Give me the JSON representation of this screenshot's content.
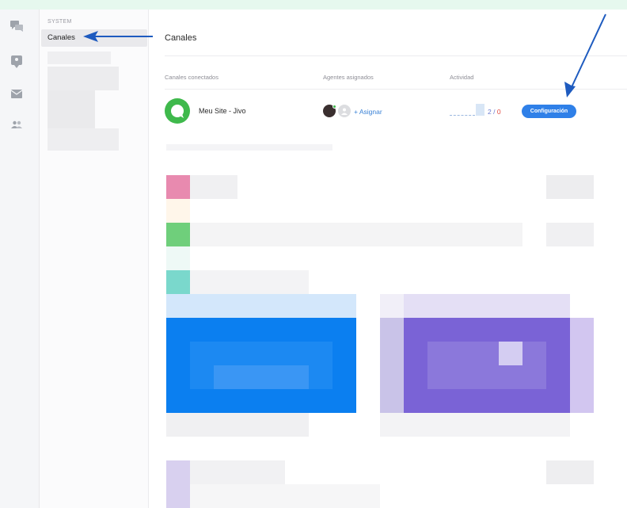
{
  "sidebar": {
    "section_label": "SYSTEM",
    "active_item": "Canales"
  },
  "main": {
    "title": "Canales",
    "columns": {
      "connected": "Canales conectados",
      "agents": "Agentes asignados",
      "activity": "Actividad"
    },
    "channel": {
      "name": "Meu Site - Jivo",
      "assign_label": "+ Asignar",
      "activity_count": "2",
      "activity_separator": "/",
      "activity_zero": "0",
      "config_label": "Configuración"
    }
  },
  "colors": {
    "accent": "#2f80e8",
    "channel_green": "#3fb94c",
    "arrow": "#1e5bbf"
  },
  "icons": [
    "chat-icon",
    "bookmark-icon",
    "mail-icon",
    "users-icon",
    "jivo-logo-icon"
  ]
}
